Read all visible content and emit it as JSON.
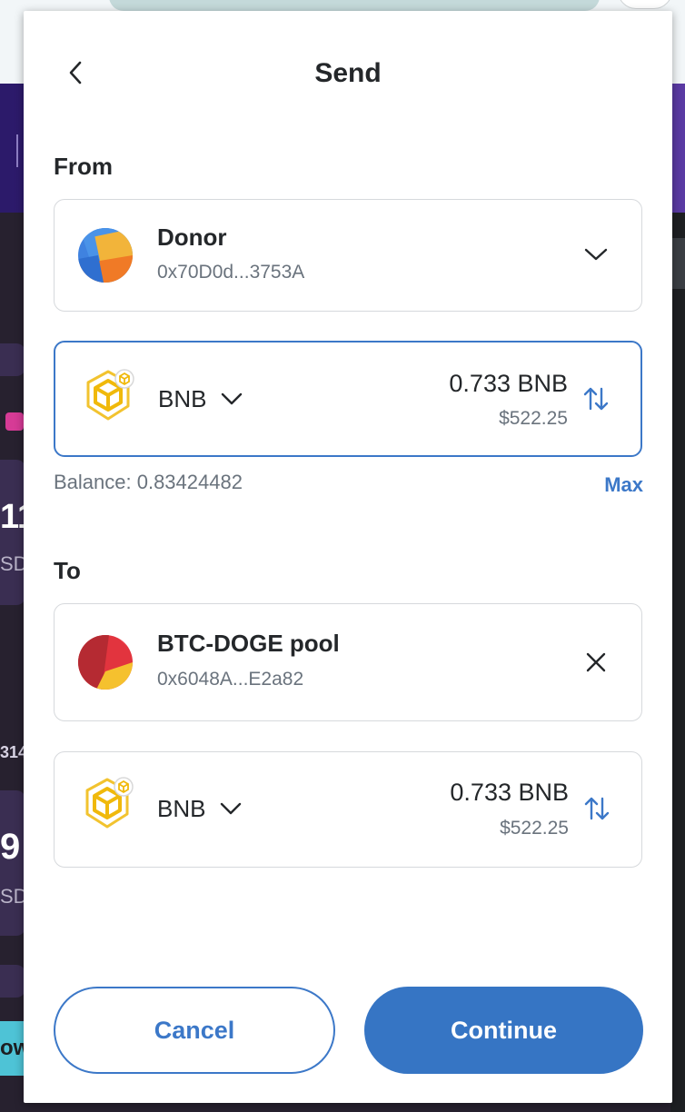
{
  "header": {
    "title": "Send"
  },
  "from": {
    "label": "From",
    "account": {
      "name": "Donor",
      "address": "0x70D0d...3753A"
    },
    "token": {
      "symbol": "BNB",
      "amount": "0.733 BNB",
      "fiat": "$522.25"
    },
    "balance": "Balance: 0.83424482",
    "max_label": "Max"
  },
  "to": {
    "label": "To",
    "account": {
      "name": "BTC-DOGE pool",
      "address": "0x6048A...E2a82"
    },
    "token": {
      "symbol": "BNB",
      "amount": "0.733 BNB",
      "fiat": "$522.25"
    }
  },
  "actions": {
    "cancel": "Cancel",
    "continue": "Continue"
  },
  "background": {
    "partial_1": "11",
    "partial_2": "SD",
    "partial_3": "314",
    "partial_4": "9",
    "partial_5": "SD",
    "partial_6": "ow"
  },
  "colors": {
    "accent": "#3c78c8",
    "primary_button": "#3675c4",
    "text": "#24272a",
    "muted": "#6a737d"
  },
  "icons": [
    "chevron-left-icon",
    "chevron-down-icon",
    "close-icon",
    "swap-arrows-icon",
    "bnb-token-icon",
    "account-avatar"
  ]
}
